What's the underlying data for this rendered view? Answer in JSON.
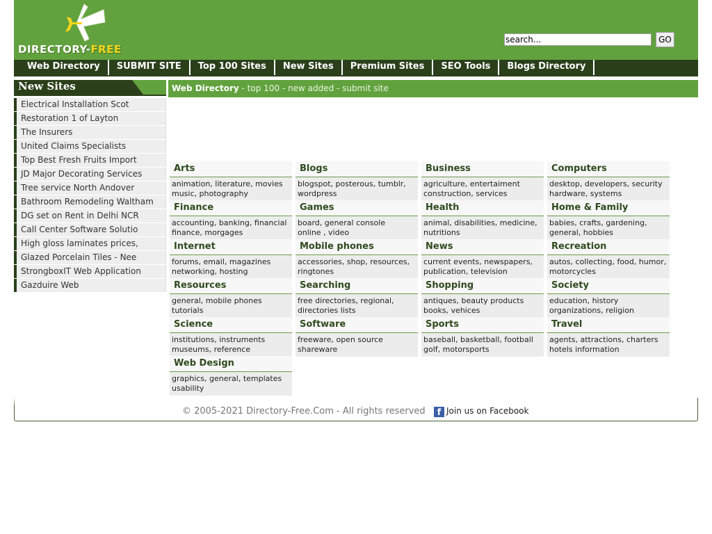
{
  "site": {
    "logo_text_main": "DIRECTORY-",
    "logo_text_accent": "FREE",
    "colors": {
      "brand_green": "#62a23e",
      "dark_green": "#2b3f1b",
      "logo_yellow": "#f5d51c"
    }
  },
  "search": {
    "placeholder": "search...",
    "value": "search...",
    "go_label": "GO"
  },
  "nav": {
    "items": [
      {
        "label": "Web Directory"
      },
      {
        "label": "SUBMIT SITE"
      },
      {
        "label": "Top 100 Sites"
      },
      {
        "label": "New Sites"
      },
      {
        "label": "Premium Sites"
      },
      {
        "label": "SEO Tools"
      },
      {
        "label": "Blogs Directory"
      }
    ]
  },
  "sidebar": {
    "title": "New Sites",
    "items": [
      {
        "label": "Electrical Installation Scot"
      },
      {
        "label": "Restoration 1 of Layton"
      },
      {
        "label": "The Insurers"
      },
      {
        "label": "United Claims Specialists"
      },
      {
        "label": "Top Best Fresh Fruits Import"
      },
      {
        "label": "JD Major Decorating Services"
      },
      {
        "label": "Tree service North Andover"
      },
      {
        "label": "Bathroom Remodeling Waltham"
      },
      {
        "label": "DG set on Rent in Delhi NCR"
      },
      {
        "label": "Call Center Software Solutio"
      },
      {
        "label": "High gloss laminates prices,"
      },
      {
        "label": "Glazed Porcelain Tiles - Nee"
      },
      {
        "label": "StrongboxIT Web Application"
      },
      {
        "label": "Gazduire Web"
      }
    ]
  },
  "breadcrumb": {
    "home": "Web Directory",
    "sep": " - ",
    "links": [
      "top 100",
      "new added",
      "submit site"
    ]
  },
  "categories": [
    {
      "title": "Arts",
      "line1": "animation, literature, movies",
      "line2": "music, photography"
    },
    {
      "title": "Blogs",
      "line1": "blogspot, posterous, tumblr,",
      "line2": "wordpress"
    },
    {
      "title": "Business",
      "line1": "agriculture, entertaiment",
      "line2": "construction, services"
    },
    {
      "title": "Computers",
      "line1": "desktop, developers, security",
      "line2": "hardware, systems"
    },
    {
      "title": "Finance",
      "line1": "accounting, banking, financial",
      "line2": "finance, morgages"
    },
    {
      "title": "Games",
      "line1": "board, general console",
      "line2": "online , video"
    },
    {
      "title": "Health",
      "line1": "animal, disabilities, medicine,",
      "line2": "nutritions"
    },
    {
      "title": "Home & Family",
      "line1": "babies, crafts, gardening,",
      "line2": "general, hobbies"
    },
    {
      "title": "Internet",
      "line1": "forums, email, magazines",
      "line2": "networking, hosting"
    },
    {
      "title": "Mobile phones",
      "line1": "accessories, shop, resources,",
      "line2": "ringtones"
    },
    {
      "title": "News",
      "line1": "current events, newspapers,",
      "line2": "publication, television"
    },
    {
      "title": "Recreation",
      "line1": "autos, collecting, food, humor,",
      "line2": "motorcycles"
    },
    {
      "title": "Resources",
      "line1": "general, mobile phones",
      "line2": "tutorials"
    },
    {
      "title": "Searching",
      "line1": "free directories, regional,",
      "line2": "directories lists"
    },
    {
      "title": "Shopping",
      "line1": "antiques, beauty products",
      "line2": "books, vehices"
    },
    {
      "title": "Society",
      "line1": "education, history",
      "line2": "organizations, religion"
    },
    {
      "title": "Science",
      "line1": "institutions, instruments",
      "line2": "museums, reference"
    },
    {
      "title": "Software",
      "line1": "freeware, open source",
      "line2": "shareware"
    },
    {
      "title": "Sports",
      "line1": "baseball, basketball, football",
      "line2": "golf, motorsports"
    },
    {
      "title": "Travel",
      "line1": "agents, attractions, charters",
      "line2": "hotels information"
    },
    {
      "title": "Web Design",
      "line1": "graphics, general, templates",
      "line2": "usability"
    }
  ],
  "footer": {
    "copyright": "© 2005-2021 Directory-Free.Com - All rights reserved",
    "facebook_icon_glyph": "f",
    "facebook_label": "Join us on Facebook"
  }
}
